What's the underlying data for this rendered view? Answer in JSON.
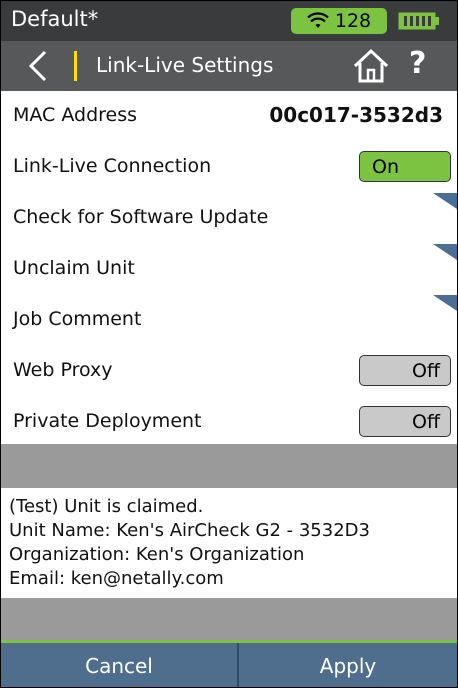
{
  "status_bar": {
    "profile": "Default*",
    "wifi_count": "128",
    "icons": [
      "wifi-icon",
      "battery-icon"
    ]
  },
  "title_bar": {
    "title": "Link-Live Settings",
    "icons": [
      "back-arrow-icon",
      "home-icon",
      "help-icon"
    ],
    "help_glyph": "?"
  },
  "settings": {
    "mac_label": "MAC Address",
    "mac_value": "00c017-3532d3",
    "linklive_label": "Link-Live Connection",
    "linklive_state": "On",
    "update_label": "Check for Software Update",
    "unclaim_label": "Unclaim Unit",
    "job_comment_label": "Job Comment",
    "web_proxy_label": "Web Proxy",
    "web_proxy_state": "Off",
    "private_label": "Private Deployment",
    "private_state": "Off"
  },
  "info": {
    "line1": "(Test) Unit is claimed.",
    "line2": "Unit Name: Ken's AirCheck G2 - 3532D3",
    "line3": "Organization: Ken's Organization",
    "line4": "Email: ken@netally.com"
  },
  "buttons": {
    "cancel": "Cancel",
    "apply": "Apply"
  },
  "colors": {
    "accent_green": "#7dc342",
    "button_blue": "#4f6e8e",
    "title_gray": "#56585a",
    "status_gray": "#3a3b3d",
    "separator_yellow": "#ffe100"
  }
}
